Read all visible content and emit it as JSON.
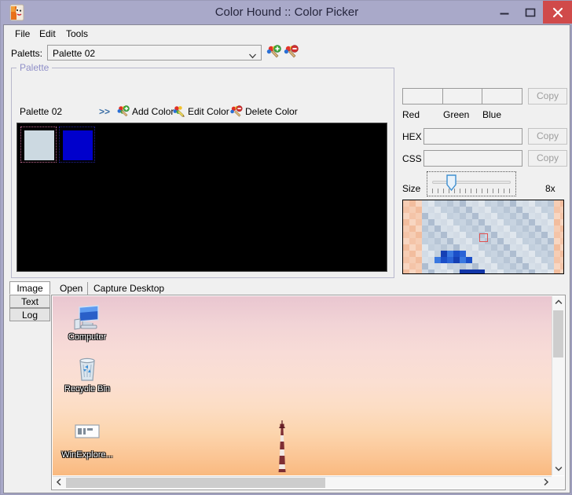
{
  "window": {
    "title": "Color Hound :: Color Picker",
    "app_icon": "dog-head-icon",
    "controls": {
      "minimize": "minimize-icon",
      "maximize": "maximize-icon",
      "close": "close-icon"
    },
    "titlebar_color": "#a9a9c9",
    "close_color": "#d04a4a"
  },
  "menubar": {
    "items": [
      {
        "label": "File"
      },
      {
        "label": "Edit"
      },
      {
        "label": "Tools"
      }
    ]
  },
  "palette_selector": {
    "label": "Paletts:",
    "selected": "Palette 02",
    "options": [
      "Palette 02"
    ],
    "dropdown_icon": "chevron-down-icon",
    "add_palette_icon": "add-palette-icon",
    "delete_palette_icon": "delete-palette-icon"
  },
  "palette_group": {
    "legend": "Palette",
    "name": "Palette 02",
    "arrows": ">>",
    "actions": [
      {
        "label": "Add Color",
        "icon": "add-color-icon"
      },
      {
        "label": "Edit Color",
        "icon": "edit-color-icon"
      },
      {
        "label": "Delete Color",
        "icon": "delete-color-icon"
      }
    ],
    "canvas_background": "#000000",
    "swatches": [
      {
        "color": "#ccd9e1",
        "selected": true
      },
      {
        "color": "#0000cc",
        "selected": false
      }
    ]
  },
  "color_panel": {
    "rgb": {
      "red": {
        "value": "",
        "label": "Red"
      },
      "green": {
        "value": "",
        "label": "Green"
      },
      "blue": {
        "value": "",
        "label": "Blue"
      },
      "copy_label": "Copy"
    },
    "hex": {
      "label": "HEX",
      "value": "",
      "copy_label": "Copy"
    },
    "css": {
      "label": "CSS",
      "value": "",
      "copy_label": "Copy"
    },
    "size": {
      "label": "Size",
      "value_label": "8x",
      "slider_position_percent": 21
    },
    "magnifier": {
      "crosshair_color": "#e05050"
    }
  },
  "lower": {
    "vertical_tabs": [
      {
        "label": "Image",
        "active": true
      },
      {
        "label": "Text",
        "active": false
      },
      {
        "label": "Log",
        "active": false
      }
    ],
    "toolbar": [
      {
        "label": "Open"
      },
      {
        "label": "Capture Desktop"
      }
    ],
    "desktop_icons": [
      {
        "label": "Computer",
        "icon": "computer-icon"
      },
      {
        "label": "Recycle Bin",
        "icon": "recycle-bin-icon"
      },
      {
        "label": "WinExplore...",
        "icon": "file-explorer-icon"
      }
    ],
    "scrollbars": {
      "vertical": {
        "up_icon": "chevron-up-icon",
        "down_icon": "chevron-down-icon"
      },
      "horizontal": {
        "left_icon": "chevron-left-icon",
        "right_icon": "chevron-right-icon"
      }
    }
  }
}
